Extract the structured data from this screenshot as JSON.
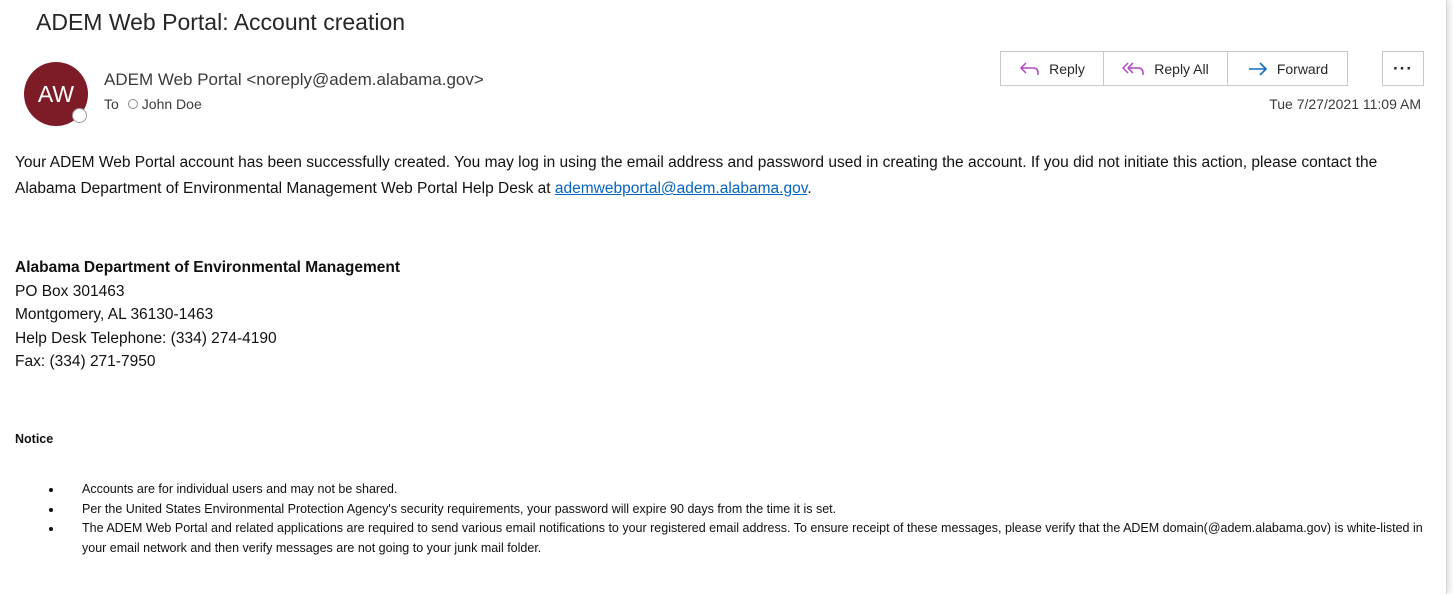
{
  "email": {
    "subject": "ADEM Web Portal: Account creation",
    "avatar_initials": "AW",
    "avatar_color": "#7d1c26",
    "sender": "ADEM Web Portal <noreply@adem.alabama.gov>",
    "to_label": "To",
    "recipient": "John Doe",
    "date": "Tue 7/27/2021 11:09 AM"
  },
  "toolbar": {
    "reply_label": "Reply",
    "reply_all_label": "Reply All",
    "forward_label": "Forward",
    "more_label": "···",
    "reply_icon": "reply-arrow-icon",
    "reply_all_icon": "reply-all-arrow-icon",
    "forward_icon": "forward-arrow-icon",
    "icon_color_reply": "#b146c2",
    "icon_color_forward": "#0f6cbd"
  },
  "body": {
    "paragraph_pre": "Your ADEM Web Portal account has been successfully created. You may log in using the email address and password used in creating the account. If you did not initiate this action, please contact the Alabama Department of Environmental Management Web Portal Help Desk at ",
    "help_email": "ademwebportal@adem.alabama.gov",
    "paragraph_post": ".",
    "link_color": "#0563c1"
  },
  "signature": {
    "org": "Alabama Department of Environmental Management",
    "po_box": "PO Box 301463",
    "city": "Montgomery, AL 36130-1463",
    "phone": "Help Desk Telephone: (334) 274-4190",
    "fax": "Fax: (334) 271-7950"
  },
  "notice": {
    "heading": "Notice",
    "items": [
      "Accounts are for individual users and may not be shared.",
      "Per the United States Environmental Protection Agency's security requirements, your password will expire 90 days from the time it is set.",
      "The ADEM Web Portal and related applications are required to send various email notifications to your registered email address. To ensure receipt of these messages, please verify that the ADEM domain(@adem.alabama.gov) is white-listed in your email network and then verify messages are not going to your junk mail folder."
    ]
  }
}
